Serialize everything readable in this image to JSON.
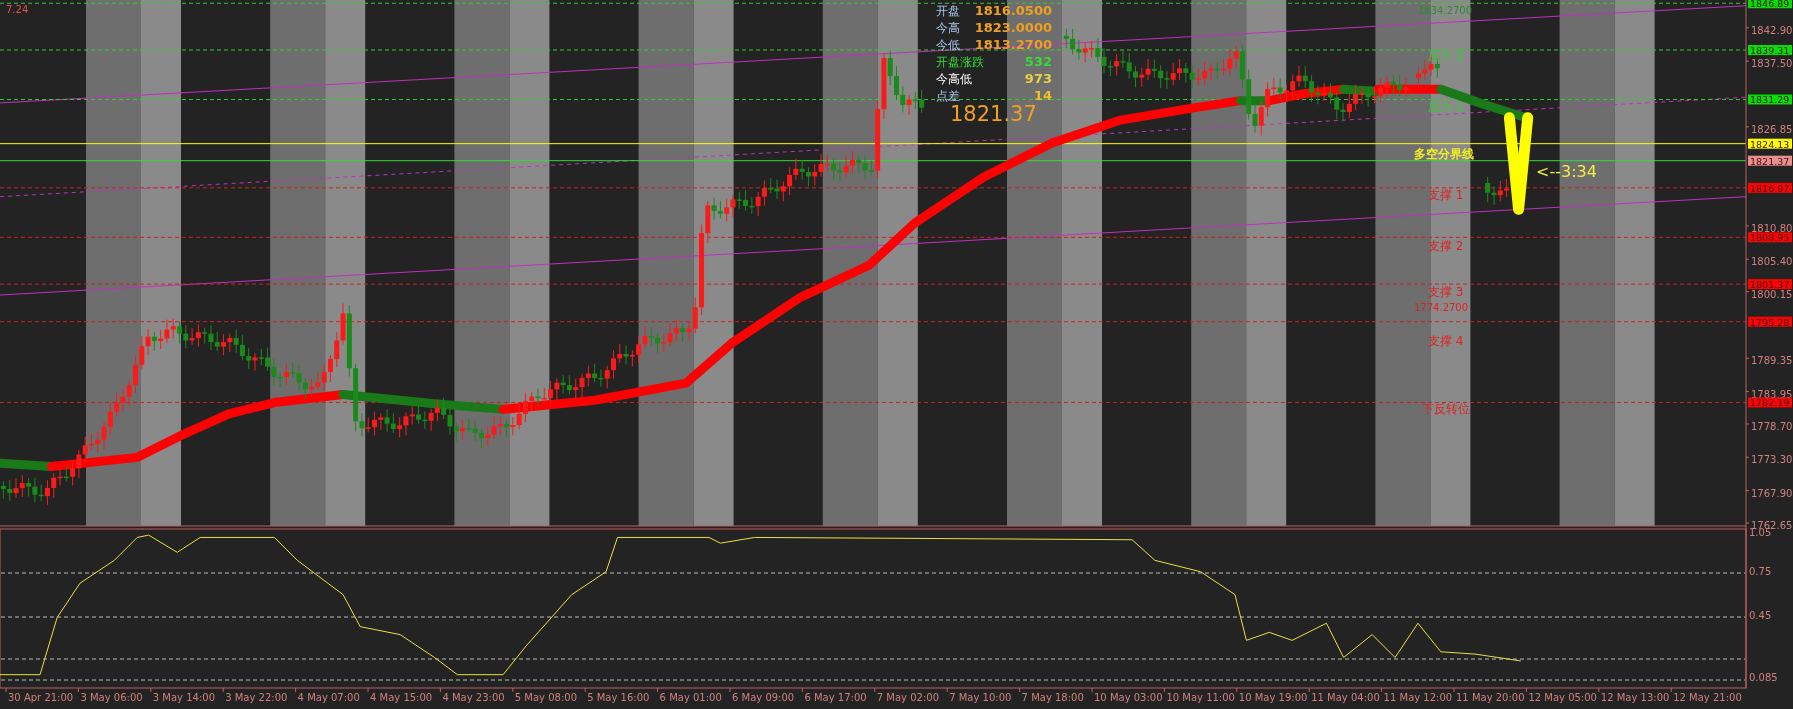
{
  "corner_label": "7.24",
  "info_panel": {
    "rows": [
      {
        "label": "开盘",
        "value": "1816.0500",
        "color": "#f0a020"
      },
      {
        "label": "今高",
        "value": "1823.0000",
        "color": "#f0a020"
      },
      {
        "label": "今低",
        "value": "1813.2700",
        "color": "#f0a020"
      },
      {
        "label": "开盘涨跌",
        "value": "532",
        "color": "#33dd33"
      },
      {
        "label": "今高低",
        "value": "973",
        "color": "#e8d040"
      },
      {
        "label": "点差",
        "value": "14",
        "color": "#f0c020"
      }
    ],
    "current_price": "1821.37"
  },
  "level_labels": [
    {
      "text": "1834.2700",
      "color": "#2e8b2e"
    },
    {
      "text": "压力 2",
      "color": "#33cc33"
    },
    {
      "text": "压力 1",
      "color": "#33cc33"
    },
    {
      "text": "多空分界线",
      "color": "#f0f020"
    },
    {
      "text": "支撑 1",
      "color": "#e02020"
    },
    {
      "text": "支撑 2",
      "color": "#e02020"
    },
    {
      "text": "支撑 3",
      "color": "#e02020"
    },
    {
      "text": "1774.2700",
      "color": "#e02020"
    },
    {
      "text": "支撑 4",
      "color": "#e02020"
    },
    {
      "text": "下反转位",
      "color": "#e02020"
    }
  ],
  "countdown": "<--3:34",
  "price_axis": {
    "ticks": [
      "1842.90",
      "1837.50",
      "1826.85",
      "1810.80",
      "1805.40",
      "1800.15",
      "1789.35",
      "1783.95",
      "1778.70",
      "1773.30",
      "1767.90",
      "1762.65"
    ],
    "tags": [
      {
        "text": "1846.89",
        "color": "#00e000"
      },
      {
        "text": "1839.31",
        "color": "#00e000"
      },
      {
        "text": "1831.29",
        "color": "#00e000"
      },
      {
        "text": "1824.13",
        "color": "#ffff00"
      },
      {
        "text": "1821.37",
        "color": "#e89090"
      },
      {
        "text": "1816.97",
        "color": "#ff0000"
      },
      {
        "text": "1808.95",
        "color": "#ff0000"
      },
      {
        "text": "1801.37",
        "color": "#ff0000"
      },
      {
        "text": "1795.28",
        "color": "#ff0000"
      },
      {
        "text": "1782.19",
        "color": "#ff0000"
      }
    ]
  },
  "indicator_axis": {
    "ticks": [
      "1.05",
      "0.75",
      "0.45",
      "0.085"
    ]
  },
  "time_axis": {
    "labels": [
      "30 Apr 21:00",
      "3 May 06:00",
      "3 May 14:00",
      "3 May 22:00",
      "4 May 07:00",
      "4 May 15:00",
      "4 May 23:00",
      "5 May 08:00",
      "5 May 16:00",
      "6 May 01:00",
      "6 May 09:00",
      "6 May 17:00",
      "7 May 02:00",
      "7 May 10:00",
      "7 May 18:00",
      "10 May 03:00",
      "10 May 11:00",
      "10 May 19:00",
      "11 May 04:00",
      "11 May 12:00",
      "11 May 20:00",
      "12 May 05:00",
      "12 May 13:00",
      "12 May 21:00"
    ]
  }
}
